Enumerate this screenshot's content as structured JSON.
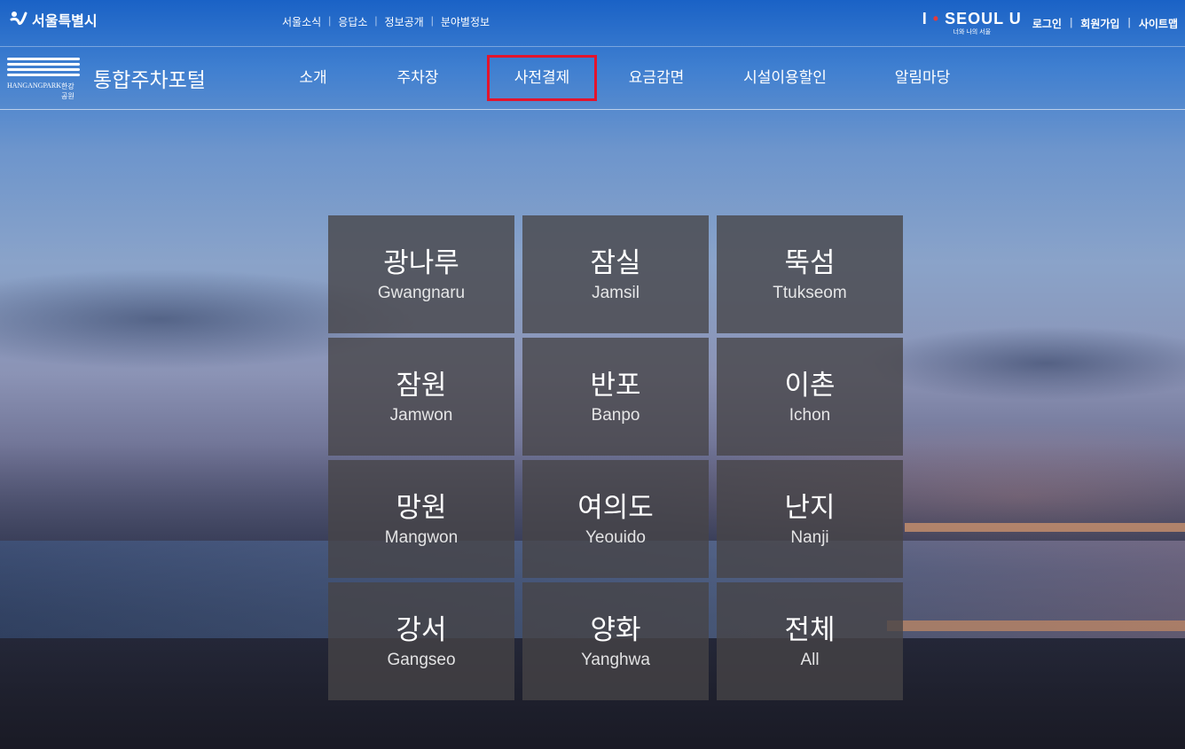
{
  "header": {
    "city_logo_text": "서울특별시",
    "util_links": [
      "서울소식",
      "응답소",
      "정보공개",
      "분야별정보"
    ],
    "brand_main_prefix": "I",
    "brand_main_suffix": "SEOUL U",
    "brand_sub": "너와 나의 서울",
    "account_links": [
      "로그인",
      "회원가입",
      "사이트맵"
    ]
  },
  "navbar": {
    "logo_caption_left": "HANGANGPARK",
    "logo_caption_right": "한강공원",
    "portal_title": "통합주차포털",
    "menu": [
      {
        "label": "소개",
        "active": false
      },
      {
        "label": "주차장",
        "active": false
      },
      {
        "label": "사전결제",
        "active": true
      },
      {
        "label": "요금감면",
        "active": false
      },
      {
        "label": "시설이용할인",
        "active": false
      },
      {
        "label": "알림마당",
        "active": false
      }
    ]
  },
  "parks": [
    {
      "ko": "광나루",
      "en": "Gwangnaru"
    },
    {
      "ko": "잠실",
      "en": "Jamsil"
    },
    {
      "ko": "뚝섬",
      "en": "Ttukseom"
    },
    {
      "ko": "잠원",
      "en": "Jamwon"
    },
    {
      "ko": "반포",
      "en": "Banpo"
    },
    {
      "ko": "이촌",
      "en": "Ichon"
    },
    {
      "ko": "망원",
      "en": "Mangwon"
    },
    {
      "ko": "여의도",
      "en": "Yeouido"
    },
    {
      "ko": "난지",
      "en": "Nanji"
    },
    {
      "ko": "강서",
      "en": "Gangseo"
    },
    {
      "ko": "양화",
      "en": "Yanghwa"
    },
    {
      "ko": "전체",
      "en": "All"
    }
  ],
  "colors": {
    "active_outline": "#e3142d",
    "tile_bg": "#464446",
    "brand_dot": "#e23b3b"
  }
}
